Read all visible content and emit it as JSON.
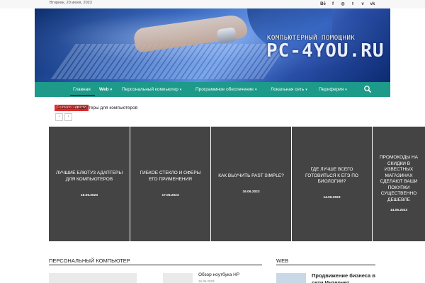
{
  "topbar": {
    "date": "Вторник, 20 июня, 2023",
    "social": [
      "Bē",
      "f",
      "◎",
      "t",
      "v",
      "vk"
    ]
  },
  "banner": {
    "subtitle": "КОМПЬЮТЕРНЫЙ ПОМОЩНИК",
    "logo": "PC-4YOU.RU"
  },
  "nav": {
    "items": [
      {
        "label": "Главная",
        "caret": ""
      },
      {
        "label": "Web",
        "caret": "▾"
      },
      {
        "label": "Персональный компьютер",
        "caret": "▾"
      },
      {
        "label": "Программное обеспечение",
        "caret": "▾"
      },
      {
        "label": "Локальная сеть",
        "caret": "▾"
      },
      {
        "label": "Периферия",
        "caret": "▾"
      }
    ]
  },
  "ticker": {
    "badge": "Свежие новости",
    "text": "Bluetooth адаптеры для компьютеров",
    "prev": "‹",
    "next": "›"
  },
  "slider": [
    {
      "title": "ЛУЧШИЕ БЛЮТУЗ АДАПТЕРЫ ДЛЯ КОМПЬЮТЕРОВ",
      "date": "18.06.2023"
    },
    {
      "title": "ГИБКОЕ СТЕКЛО И ОФЕРЫ ЕГО ПРИМЕНЕНИЯ",
      "date": "17.06.2023"
    },
    {
      "title": "КАК ВЫУЧИТЬ PAST SIMPLE?",
      "date": "16.06.2023"
    },
    {
      "title": "ГДЕ ЛУЧШЕ ВСЕГО ГОТОВИТЬСЯ К ЕГЭ ПО БИОЛОГИИ?",
      "date": "14.06.2023"
    },
    {
      "title": "ПРОМОКОДЫ НА СКИДКИ В ИЗВЕСТНЫХ МАГАЗИНАХ СДЕЛАЮТ ВАШИ ПОКУПКИ СУЩЕСТВЕННО ДЕШЕВЛЕ",
      "date": "14.06.2023"
    }
  ],
  "sections": {
    "pc": {
      "title": "ПЕРСОНАЛЬНЫЙ КОМПЬЮТЕР",
      "item_title": "Обзор ноутбука HP",
      "item_date": "16.06.2023"
    },
    "web": {
      "title": "WEB",
      "item_title": "Продвижение бизнеса в сети Интернет"
    }
  },
  "colors": {
    "nav": "#1d9a8a",
    "tile": "#444444",
    "badge": "#e02b2b"
  }
}
